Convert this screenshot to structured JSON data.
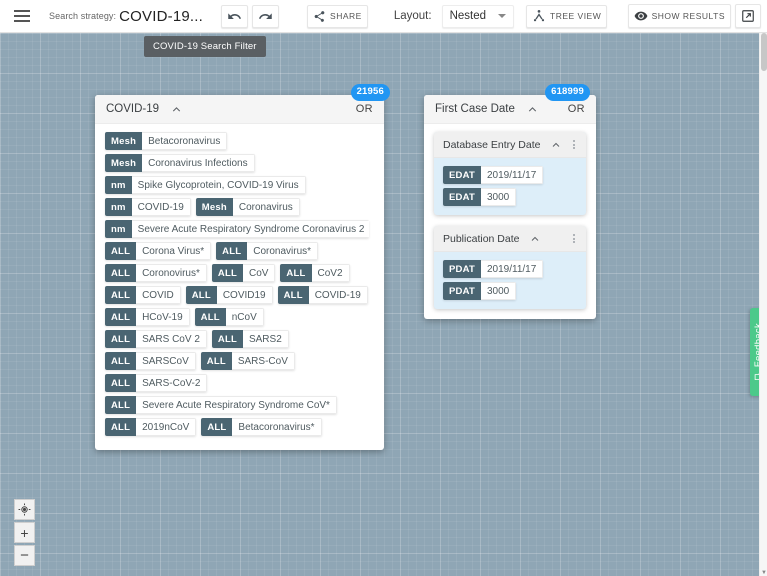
{
  "toolbar": {
    "menu_icon": "hamburger-menu-icon",
    "search_strategy_label": "Search strategy:",
    "search_strategy_value": "COVID-19...",
    "undo_label": "undo-icon",
    "redo_label": "redo-icon",
    "share_label": "SHARE",
    "layout_label": "Layout:",
    "layout_value": "Nested",
    "layout_options": [
      "Nested"
    ],
    "tree_view_label": "TREE VIEW",
    "show_results_label": "SHOW RESULTS",
    "open_external_label": "open-in-new-icon"
  },
  "tooltip": {
    "text": "COVID-19 Search Filter"
  },
  "canvas": {
    "background_color": "#8fa6b5",
    "badge_color": "#2196f3",
    "tag_color": "#4a6572",
    "inner_card_color": "#ddeef9"
  },
  "groups": [
    {
      "id": "covid",
      "title": "COVID-19",
      "operator": "OR",
      "count": "21956",
      "rows": [
        [
          {
            "tag": "Mesh",
            "value": "Betacoronavirus"
          }
        ],
        [
          {
            "tag": "Mesh",
            "value": "Coronavirus Infections"
          }
        ],
        [
          {
            "tag": "nm",
            "value": "Spike Glycoprotein, COVID-19 Virus"
          }
        ],
        [
          {
            "tag": "nm",
            "value": "COVID-19"
          },
          {
            "tag": "Mesh",
            "value": "Coronavirus"
          }
        ],
        [
          {
            "tag": "nm",
            "value": "Severe Acute Respiratory Syndrome Coronavirus 2"
          }
        ],
        [
          {
            "tag": "ALL",
            "value": "Corona Virus*"
          },
          {
            "tag": "ALL",
            "value": "Coronavirus*"
          }
        ],
        [
          {
            "tag": "ALL",
            "value": "Coronovirus*"
          },
          {
            "tag": "ALL",
            "value": "CoV"
          },
          {
            "tag": "ALL",
            "value": "CoV2"
          }
        ],
        [
          {
            "tag": "ALL",
            "value": "COVID"
          },
          {
            "tag": "ALL",
            "value": "COVID19"
          },
          {
            "tag": "ALL",
            "value": "COVID-19"
          }
        ],
        [
          {
            "tag": "ALL",
            "value": "HCoV-19"
          },
          {
            "tag": "ALL",
            "value": "nCoV"
          }
        ],
        [
          {
            "tag": "ALL",
            "value": "SARS CoV 2"
          },
          {
            "tag": "ALL",
            "value": "SARS2"
          }
        ],
        [
          {
            "tag": "ALL",
            "value": "SARSCoV"
          },
          {
            "tag": "ALL",
            "value": "SARS-CoV"
          }
        ],
        [
          {
            "tag": "ALL",
            "value": "SARS-CoV-2"
          }
        ],
        [
          {
            "tag": "ALL",
            "value": "Severe Acute Respiratory Syndrome CoV*"
          }
        ],
        [
          {
            "tag": "ALL",
            "value": "2019nCoV"
          },
          {
            "tag": "ALL",
            "value": "Betacoronavirus*"
          }
        ]
      ]
    },
    {
      "id": "date",
      "title": "First Case Date",
      "operator": "OR",
      "count": "618999",
      "inner_cards": [
        {
          "title": "Database Entry Date",
          "rows": [
            [
              {
                "tag": "EDAT",
                "value": "2019/11/17"
              }
            ],
            [
              {
                "tag": "EDAT",
                "value": "3000"
              }
            ]
          ]
        },
        {
          "title": "Publication Date",
          "rows": [
            [
              {
                "tag": "PDAT",
                "value": "2019/11/17"
              }
            ],
            [
              {
                "tag": "PDAT",
                "value": "3000"
              }
            ]
          ]
        }
      ]
    }
  ],
  "zoom_controls": {
    "recenter_label": "recenter-icon",
    "zoom_in_label": "+",
    "zoom_out_label": "−"
  },
  "feedback": {
    "label": "Feedback",
    "color": "#4cc98a"
  }
}
